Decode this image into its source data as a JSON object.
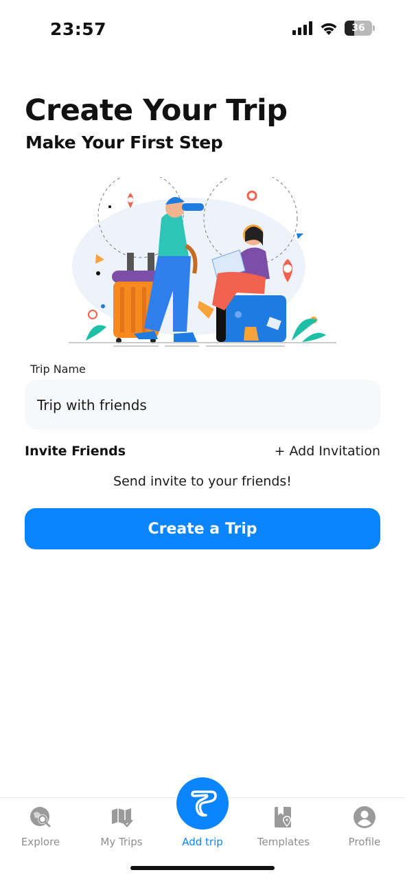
{
  "status_bar": {
    "time": "23:57",
    "battery": "36",
    "icons": [
      "cellular-signal-icon",
      "wifi-icon",
      "battery-icon"
    ]
  },
  "header": {
    "title": "Create Your Trip",
    "subtitle": "Make Your First Step"
  },
  "form": {
    "trip_name_label": "Trip Name",
    "trip_name_value": "Trip with friends",
    "invite_label": "Invite Friends",
    "add_invitation": "+ Add Invitation",
    "invite_hint": "Send invite to your friends!",
    "create_button": "Create a Trip"
  },
  "tab_bar": {
    "active": "add-trip",
    "accent_color": "#0a84ff",
    "inactive_color": "#8e8e8e",
    "tabs": [
      {
        "id": "explore",
        "label": "Explore",
        "icon": "globe-search-icon"
      },
      {
        "id": "my-trips",
        "label": "My Trips",
        "icon": "map-check-icon"
      },
      {
        "id": "add-trip",
        "label": "Add trip",
        "icon": "app-logo-icon"
      },
      {
        "id": "templates",
        "label": "Templates",
        "icon": "template-pin-icon"
      },
      {
        "id": "profile",
        "label": "Profile",
        "icon": "user-circle-icon"
      }
    ]
  }
}
